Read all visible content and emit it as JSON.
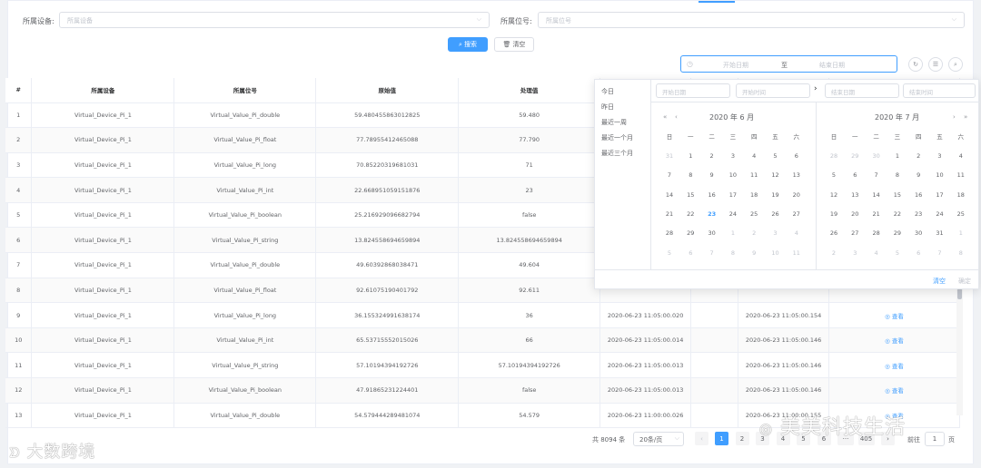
{
  "filters": {
    "device_label": "所属设备:",
    "device_placeholder": "所属设备",
    "position_label": "所属位号:",
    "position_placeholder": "所属位号",
    "search_label": "搜索",
    "clear_label": "清空",
    "date_start": "开始日期",
    "date_sep": "至",
    "date_end": "结束日期"
  },
  "table": {
    "headers": [
      "#",
      "所属设备",
      "所属位号",
      "原始值",
      "处理值",
      "",
      "",
      "",
      ""
    ],
    "rows": [
      {
        "idx": "1",
        "device": "Virtual_Device_Pi_1",
        "pos": "Virtual_Value_Pi_double",
        "raw": "59.480455863012825",
        "proc": "59.480",
        "t1": "",
        "t2": "",
        "action": ""
      },
      {
        "idx": "2",
        "device": "Virtual_Device_Pi_1",
        "pos": "Virtual_Value_Pi_float",
        "raw": "77.78955412465088",
        "proc": "77.790",
        "t1": "",
        "t2": "",
        "action": ""
      },
      {
        "idx": "3",
        "device": "Virtual_Device_Pi_1",
        "pos": "Virtual_Value_Pi_long",
        "raw": "70.85220319681031",
        "proc": "71",
        "t1": "",
        "t2": "",
        "action": ""
      },
      {
        "idx": "4",
        "device": "Virtual_Device_Pi_1",
        "pos": "Virtual_Value_Pi_int",
        "raw": "22.668951059151876",
        "proc": "23",
        "t1": "",
        "t2": "",
        "action": ""
      },
      {
        "idx": "5",
        "device": "Virtual_Device_Pi_1",
        "pos": "Virtual_Value_Pi_boolean",
        "raw": "25.216929096682794",
        "proc": "false",
        "t1": "",
        "t2": "",
        "action": ""
      },
      {
        "idx": "6",
        "device": "Virtual_Device_Pi_1",
        "pos": "Virtual_Value_Pi_string",
        "raw": "13.824558694659894",
        "proc": "13.824558694659894",
        "t1": "",
        "t2": "",
        "action": ""
      },
      {
        "idx": "7",
        "device": "Virtual_Device_Pi_1",
        "pos": "Virtual_Value_Pi_double",
        "raw": "49.60392868038471",
        "proc": "49.604",
        "t1": "",
        "t2": "",
        "action": ""
      },
      {
        "idx": "8",
        "device": "Virtual_Device_Pi_1",
        "pos": "Virtual_Value_Pi_float",
        "raw": "92.61075190401792",
        "proc": "92.611",
        "t1": "",
        "t2": "",
        "action": ""
      },
      {
        "idx": "9",
        "device": "Virtual_Device_Pi_1",
        "pos": "Virtual_Value_Pi_long",
        "raw": "36.155324991638174",
        "proc": "36",
        "t1": "2020-06-23 11:05:00.020",
        "t2": "2020-06-23 11:05:00.154",
        "action": "查看"
      },
      {
        "idx": "10",
        "device": "Virtual_Device_Pi_1",
        "pos": "Virtual_Value_Pi_int",
        "raw": "65.53715552015026",
        "proc": "66",
        "t1": "2020-06-23 11:05:00.014",
        "t2": "2020-06-23 11:05:00.146",
        "action": "查看"
      },
      {
        "idx": "11",
        "device": "Virtual_Device_Pi_1",
        "pos": "Virtual_Value_Pi_string",
        "raw": "57.10194394192726",
        "proc": "57.10194394192726",
        "t1": "2020-06-23 11:05:00.013",
        "t2": "2020-06-23 11:05:00.146",
        "action": "查看"
      },
      {
        "idx": "12",
        "device": "Virtual_Device_Pi_1",
        "pos": "Virtual_Value_Pi_boolean",
        "raw": "47.91865231224401",
        "proc": "false",
        "t1": "2020-06-23 11:05:00.013",
        "t2": "2020-06-23 11:05:00.146",
        "action": "查看"
      },
      {
        "idx": "13",
        "device": "Virtual_Device_Pi_1",
        "pos": "Virtual_Value_Pi_double",
        "raw": "54.579444289481074",
        "proc": "54.579",
        "t1": "2020-06-23 11:00:00.026",
        "t2": "2020-06-23 11:00:00.155",
        "action": "查看"
      }
    ]
  },
  "pagination": {
    "total": "共 8094 条",
    "page_size": "20条/页",
    "pages": [
      "1",
      "2",
      "3",
      "4",
      "5",
      "6",
      "···",
      "405"
    ],
    "goto_label": "前往",
    "goto_value": "1",
    "page_suffix": "页"
  },
  "picker": {
    "shortcuts": [
      "今日",
      "昨日",
      "最近一周",
      "最近一个月",
      "最近三个月"
    ],
    "start_date_ph": "开始日期",
    "start_time_ph": "开始时间",
    "end_date_ph": "结束日期",
    "end_time_ph": "结束时间",
    "left_title": "2020 年 6 月",
    "right_title": "2020 年 7 月",
    "weekdays": [
      "日",
      "一",
      "二",
      "三",
      "四",
      "五",
      "六"
    ],
    "left_days": [
      [
        "31",
        "1",
        "2",
        "3",
        "4",
        "5",
        "6"
      ],
      [
        "7",
        "8",
        "9",
        "10",
        "11",
        "12",
        "13"
      ],
      [
        "14",
        "15",
        "16",
        "17",
        "18",
        "19",
        "20"
      ],
      [
        "21",
        "22",
        "23",
        "24",
        "25",
        "26",
        "27"
      ],
      [
        "28",
        "29",
        "30",
        "1",
        "2",
        "3",
        "4"
      ],
      [
        "5",
        "6",
        "7",
        "8",
        "9",
        "10",
        "11"
      ]
    ],
    "right_days": [
      [
        "28",
        "29",
        "30",
        "1",
        "2",
        "3",
        "4"
      ],
      [
        "5",
        "6",
        "7",
        "8",
        "9",
        "10",
        "11"
      ],
      [
        "12",
        "13",
        "14",
        "15",
        "16",
        "17",
        "18"
      ],
      [
        "19",
        "20",
        "21",
        "22",
        "23",
        "24",
        "25"
      ],
      [
        "26",
        "27",
        "28",
        "29",
        "30",
        "31",
        "1"
      ],
      [
        "2",
        "3",
        "4",
        "5",
        "6",
        "7",
        "8"
      ]
    ],
    "clear_label": "清空",
    "confirm_label": "确定"
  },
  "watermarks": {
    "left": "大数跨境",
    "right": "美美科技生活"
  },
  "colors": {
    "primary": "#409eff",
    "border": "#dcdfe6"
  }
}
